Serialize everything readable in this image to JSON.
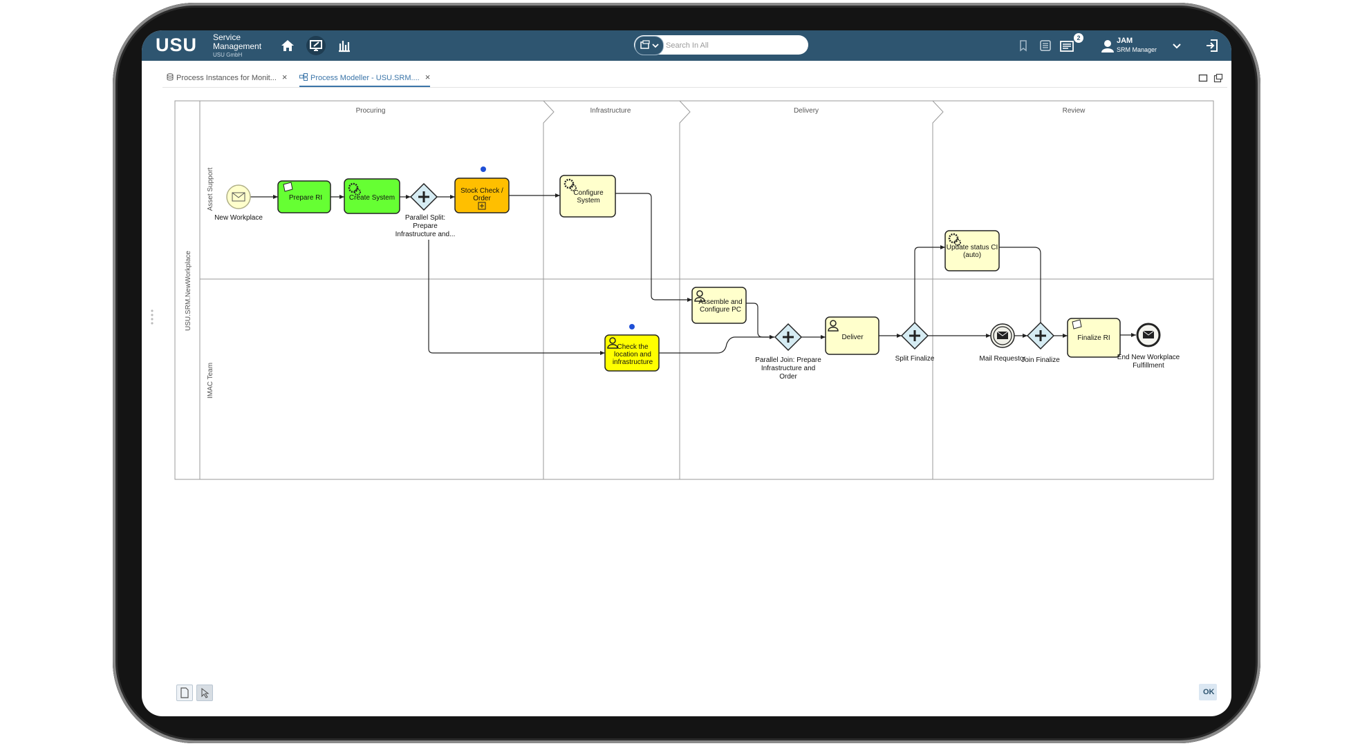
{
  "app": {
    "logo": "USU",
    "brand_line1": "Service",
    "brand_line2": "Management",
    "company": "USU GmbH"
  },
  "search": {
    "placeholder": "Search In All"
  },
  "notifications": {
    "count": "2"
  },
  "user": {
    "name": "JAM",
    "role": "SRM Manager"
  },
  "tabs": [
    {
      "label": "Process Instances for Monit...",
      "active": false
    },
    {
      "label": "Process Modeller - USU.SRM....",
      "active": true
    }
  ],
  "diagram": {
    "pool_label": "USU.SRM.NewWorkplace",
    "lanes": [
      "Asset Support",
      "IMAC Team"
    ],
    "phases": [
      "Procuring",
      "Infrastructure",
      "Delivery",
      "Review"
    ],
    "events": {
      "start_label": "New Workplace",
      "mail_label": "Mail Requestor",
      "end_label_1": "End New Workplace",
      "end_label_2": "Fulfillment"
    },
    "tasks": {
      "prepare_ri": "Prepare RI",
      "create_system": "Create System",
      "stock_check_1": "Stock Check /",
      "stock_check_2": "Order",
      "configure_1": "Configure",
      "configure_2": "System",
      "update_status_1": "Update status CI",
      "update_status_2": "(auto)",
      "assemble_1": "Assemble and",
      "assemble_2": "Configure PC",
      "check_loc_1": "Check the",
      "check_loc_2": "location and",
      "check_loc_3": "infrastructure",
      "deliver": "Deliver",
      "finalize_ri": "Finalize RI"
    },
    "gateways": {
      "split_1": "Parallel Split:",
      "split_2": "Prepare",
      "split_3": "Infrastructure and...",
      "join_1": "Parallel Join: Prepare",
      "join_2": "Infrastructure and",
      "join_3": "Order",
      "split_finalize": "Split Finalize",
      "join_finalize": "Join Finalize"
    },
    "colors": {
      "task_green": "#66ff33",
      "task_orange": "#ffbf00",
      "task_yellow": "#ffff00",
      "task_default": "#ffffcc",
      "gateway": "#d6ecf3",
      "marker_dot": "#1f4fd6"
    }
  },
  "footer": {
    "ok_label": "OK"
  }
}
